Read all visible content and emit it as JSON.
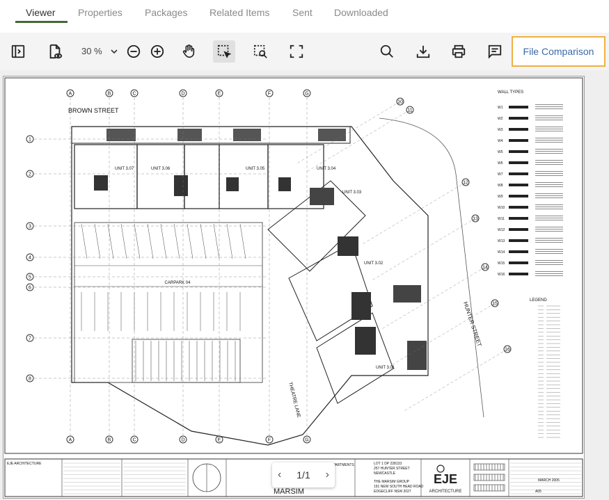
{
  "tabs": [
    {
      "label": "Viewer",
      "active": true
    },
    {
      "label": "Properties",
      "active": false
    },
    {
      "label": "Packages",
      "active": false
    },
    {
      "label": "Related Items",
      "active": false
    },
    {
      "label": "Sent",
      "active": false
    },
    {
      "label": "Downloaded",
      "active": false
    }
  ],
  "toolbar": {
    "zoom": "30 %",
    "file_comparison": "File Comparison"
  },
  "icons": [
    "sidebar-toggle-icon",
    "file-view-icon",
    "chevron-down-icon",
    "zoom-out-icon",
    "zoom-in-icon",
    "hand-pan-icon",
    "select-area-icon",
    "area-zoom-icon",
    "fullscreen-icon",
    "search-icon",
    "download-icon",
    "print-icon",
    "comment-icon"
  ],
  "accent": {
    "tab_underline": "#3d6b35",
    "highlight_border": "#f0b040",
    "link": "#3a6aa8"
  },
  "drawing": {
    "street_top": "BROWN STREET",
    "street_right": "HUNTER STREET",
    "street_bottom": "THEATRE LANE",
    "carpark": "CARPARK 04",
    "units": [
      "UNIT 3.07",
      "UNIT 3.06",
      "UNIT 3.05",
      "UNIT 3.04",
      "UNIT 3.03",
      "UNIT 3.02",
      "UNIT 3.01"
    ],
    "grid_top": [
      "A",
      "B",
      "C",
      "D",
      "E",
      "F",
      "G"
    ],
    "grid_left": [
      "1",
      "2",
      "3",
      "4",
      "5",
      "6",
      "7",
      "8"
    ],
    "grid_right": [
      "10",
      "11",
      "12",
      "13",
      "14",
      "15",
      "16"
    ],
    "legend_title": "WALL TYPES",
    "wall_types": [
      "W1",
      "W2",
      "W3",
      "W4",
      "W5",
      "W6",
      "W7",
      "W8",
      "W9",
      "W10",
      "W11",
      "W12",
      "W13",
      "W14",
      "W15",
      "W16"
    ],
    "legend": "LEGEND",
    "title_block": {
      "firm": "EJE ARCHITECTURE",
      "project": "APARTMENTS",
      "lot": "LOT 1 DP 228133",
      "address1": "257 HUNTER STREET",
      "address2": "NEWCASTLE",
      "client1": "THE MARSIM GROUP",
      "client2": "191 NEW SOUTH HEAD ROAD",
      "client3": "EDGECLIFF NSW 2027",
      "client_logo": "MARSIM",
      "logo_sub": "ARCHITECTURE",
      "date": "MARCH 2005",
      "drawing_no": "A05"
    }
  },
  "pager": {
    "label": "1/1"
  }
}
